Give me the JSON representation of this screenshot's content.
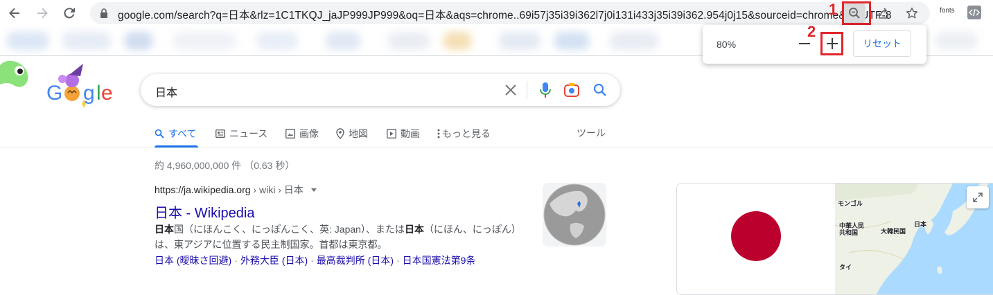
{
  "browser": {
    "url": "google.com/search?q=日本&rlz=1C1TKQJ_jaJP999JP999&oq=日本&aqs=chrome..69i57j35i39i362l7j0i131i433j35i39i362.954j0j15&sourceid=chrome&ie=UTF-8",
    "extension_label": "fonts",
    "icons": [
      "back-icon",
      "forward-icon",
      "reload-icon",
      "lock-icon",
      "zoom-out-icon",
      "share-icon",
      "star-icon",
      "code-icon"
    ]
  },
  "annotations": {
    "step1": "1",
    "step2": "2",
    "color": "#e0262b"
  },
  "zoom_popup": {
    "level": "80%",
    "minus_symbol": "−",
    "plus_symbol": "+",
    "reset_label": "リセット"
  },
  "search": {
    "query": "日本",
    "icons": [
      "clear-icon",
      "mic-icon",
      "lens-icon",
      "search-icon"
    ]
  },
  "tabs": [
    {
      "label": "すべて",
      "icon": "search-icon",
      "active": true
    },
    {
      "label": "ニュース",
      "icon": "news-icon"
    },
    {
      "label": "画像",
      "icon": "image-icon"
    },
    {
      "label": "地図",
      "icon": "map-pin-icon"
    },
    {
      "label": "動画",
      "icon": "video-icon"
    },
    {
      "label": "もっと見る",
      "icon": "more-vert-icon"
    }
  ],
  "tools_label": "ツール",
  "result_stats": "約 4,960,000,000 件 （0.63 秒）",
  "result": {
    "cite_domain": "https://ja.wikipedia.org",
    "cite_path": " › wiki › 日本",
    "title": "日本 - Wikipedia",
    "snippet_line1_b1": "日本",
    "snippet_line1_a": "国（にほんこく、にっぽんこく、英: Japan）、または",
    "snippet_line1_b2": "日本",
    "snippet_line1_c": "（にほん、にっぽん）",
    "snippet_line2": "は、東アジアに位置する民主制国家。首都は東京都。",
    "sublinks": [
      "日本 (曖昧さ回避)",
      "外務大臣 (日本)",
      "最高裁判所 (日本)",
      "日本国憲法第9条"
    ]
  },
  "map_labels": {
    "mongolia": "モンゴル",
    "china": "中華人民\n共和国",
    "korea": "大韓民国",
    "japan": "日本",
    "thailand": "タイ"
  },
  "colors": {
    "link": "#1a0dab",
    "accent": "#1a73e8",
    "flag_red": "#bc002d"
  }
}
